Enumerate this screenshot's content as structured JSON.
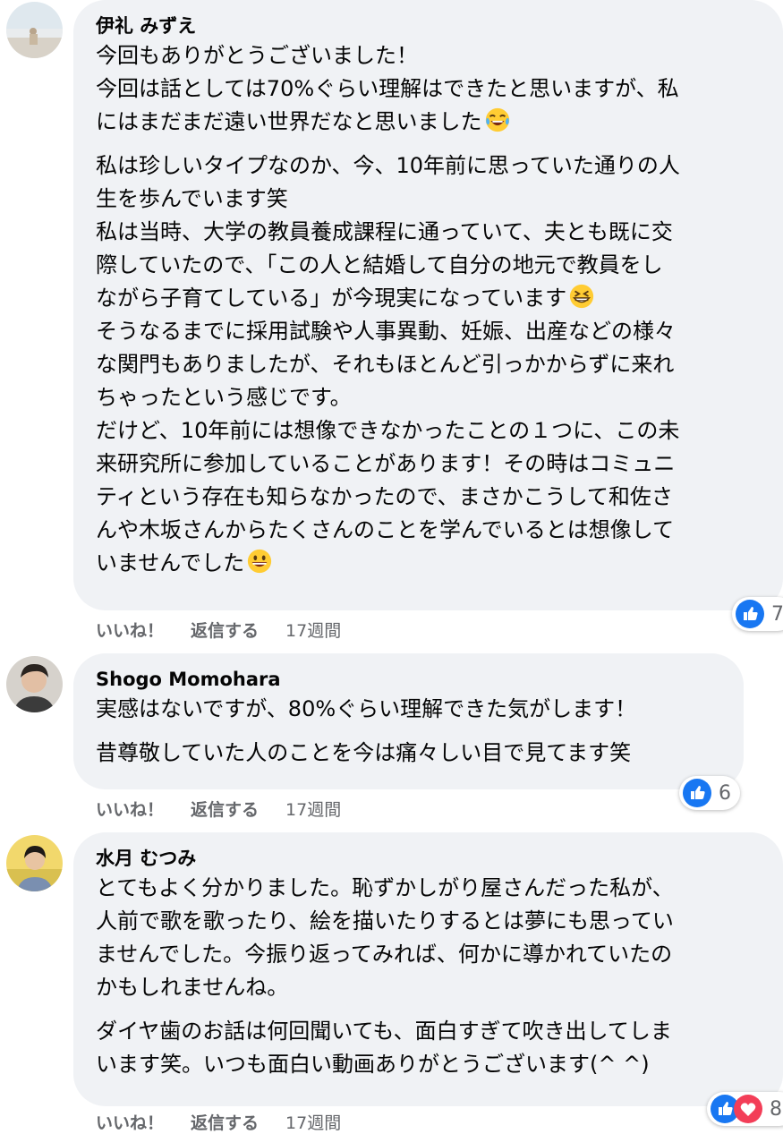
{
  "comments": [
    {
      "author": "伊礼 みずえ",
      "paragraphs": [
        [
          "今回もありがとうございました！",
          "今回は話としては70%ぐらい理解はできたと思いますが、私",
          "にはまだまだ遠い世界だなと思いました"
        ],
        [
          "私は珍しいタイプなのか、今、10年前に思っていた通りの人",
          "生を歩んでいます笑",
          "私は当時、大学の教員養成課程に通っていて、夫とも既に交",
          "際していたので、「この人と結婚して自分の地元で教員をし",
          "ながら子育てしている」が今現実になっています",
          "そうなるまでに採用試験や人事異動、妊娠、出産などの様々",
          "な関門もありましたが、それもほとんど引っかからずに来れ",
          "ちゃったという感じです。",
          "だけど、10年前には想像できなかったことの１つに、この未",
          "来研究所に参加していることがあります！その時はコミュニ",
          "ティという存在も知らなかったので、まさかこうして和佐さ",
          "んや木坂さんからたくさんのことを学んでいるとは想像して",
          "いませんでした"
        ]
      ],
      "like_label": "いいね！",
      "reply_label": "返信する",
      "time": "17週間",
      "reaction_count": "7"
    },
    {
      "author": "Shogo Momohara",
      "paragraphs": [
        [
          "実感はないですが、80%ぐらい理解できた気がします！"
        ],
        [
          "昔尊敬していた人のことを今は痛々しい目で見てます笑"
        ]
      ],
      "like_label": "いいね！",
      "reply_label": "返信する",
      "time": "17週間",
      "reaction_count": "6"
    },
    {
      "author": "水月 むつみ",
      "paragraphs": [
        [
          "とてもよく分かりました。恥ずかしがり屋さんだった私が、",
          "人前で歌を歌ったり、絵を描いたりするとは夢にも思ってい",
          "ませんでした。今振り返ってみれば、何かに導かれていたの",
          "かもしれませんね。"
        ],
        [
          "ダイヤ歯のお話は何回聞いても、面白すぎて吹き出してしま",
          "います笑。いつも面白い動画ありがとうございます(^ ^)"
        ]
      ],
      "like_label": "いいね！",
      "reply_label": "返信する",
      "time": "17週間",
      "reaction_count": "8"
    }
  ],
  "emojis": [
    "tears-of-joy-emoji",
    "grinning-squinting-emoji",
    "grinning-emoji"
  ],
  "colors": {
    "bubble": "#f0f2f5",
    "like_blue": "#1877f2",
    "love_red": "#f33e58",
    "meta_gray": "#65676b"
  }
}
